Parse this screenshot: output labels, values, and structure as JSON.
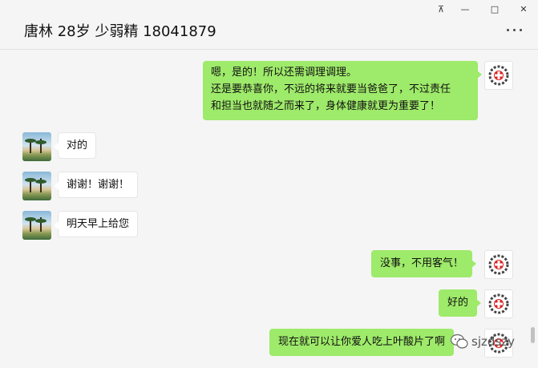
{
  "header": {
    "title": "唐林 28岁 少弱精 18041879",
    "window_controls": [
      "pin-icon",
      "minimize-icon",
      "maximize-icon",
      "close-icon"
    ],
    "window_glyphs": [
      "⊼",
      "—",
      "□",
      "✕"
    ],
    "more_icon": "more-icon"
  },
  "messages": [
    {
      "side": "out",
      "text": "嗯，是的！所以还需调理调理。\n还是要恭喜你，不远的将来就要当爸爸了，不过责任\n和担当也就随之而来了，身体健康就更为重要了！"
    },
    {
      "side": "in",
      "text": "对的"
    },
    {
      "side": "in",
      "text": "谢谢！谢谢！"
    },
    {
      "side": "in",
      "text": "明天早上给您"
    },
    {
      "side": "out",
      "text": "没事，不用客气！"
    },
    {
      "side": "out",
      "text": "好的"
    },
    {
      "side": "out",
      "text": "现在就可以让你爱人吃上叶酸片了啊"
    }
  ],
  "watermark": {
    "text": "sjzdszy",
    "icon": "wechat-icon"
  },
  "colors": {
    "background": "#f5f5f5",
    "outgoing_bubble": "#9eea6a",
    "incoming_bubble": "#ffffff"
  }
}
